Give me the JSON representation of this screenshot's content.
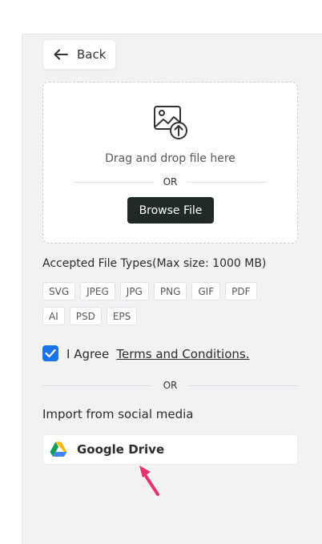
{
  "back": {
    "label": "Back"
  },
  "dropzone": {
    "drag_text": "Drag and drop file here",
    "or_text": "OR",
    "browse_label": "Browse File"
  },
  "file_types": {
    "title": "Accepted File Types(Max size: 1000 MB)",
    "row1": [
      "SVG",
      "JPEG",
      "JPG",
      "PNG",
      "GIF",
      "PDF"
    ],
    "row2": [
      "AI",
      "PSD",
      "EPS"
    ]
  },
  "agree": {
    "checked": true,
    "text": "I Agree",
    "link": "Terms and Conditions."
  },
  "divider": {
    "or_text": "OR"
  },
  "import": {
    "title": "Import from social media",
    "google_drive_label": "Google Drive"
  },
  "colors": {
    "panel_bg": "#f2f2f5",
    "browse_bg": "#1f2a27",
    "checkbox_blue": "#1a73e8",
    "pointer_pink": "#e8336d"
  }
}
